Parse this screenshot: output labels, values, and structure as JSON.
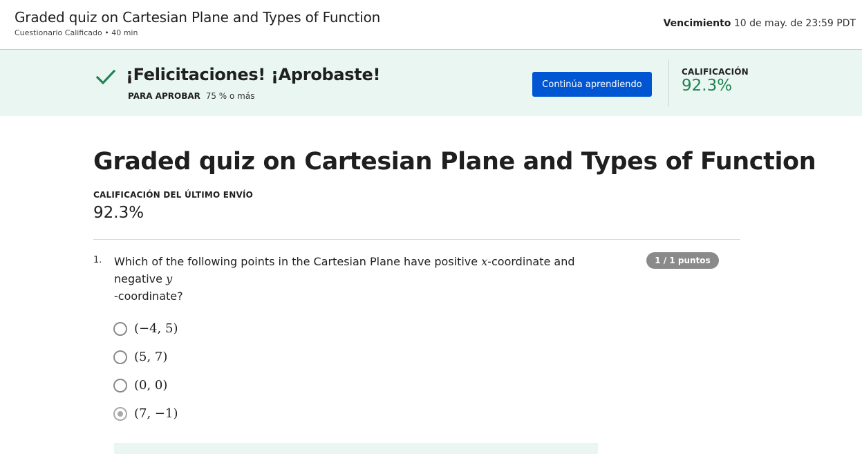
{
  "header": {
    "title": "Graded quiz on Cartesian Plane and Types of Function",
    "subtitle": "Cuestionario Calificado • 40 min",
    "due_label": "Vencimiento",
    "due_value": "10 de may. de 23:59 PDT"
  },
  "banner": {
    "headline": "¡Felicitaciones! ¡Aprobaste!",
    "pass_label": "PARA APROBAR",
    "pass_value": "75 % o más",
    "continue_label": "Continúa aprendiendo",
    "grade_label": "CALIFICACIÓN",
    "grade_value": "92.3%",
    "success_color": "#1f8354",
    "accent_color": "#0056d2",
    "icon": "checkmark-icon"
  },
  "main": {
    "title": "Graded quiz on Cartesian Plane and Types of Function",
    "last_label": "CALIFICACIÓN DEL ÚLTIMO ENVÍO",
    "last_value": "92.3%"
  },
  "question": {
    "number": "1.",
    "text_part1": "Which of the following points in the Cartesian Plane have positive ",
    "var_x": "x",
    "text_part2": "-coordinate and negative ",
    "var_y": "y",
    "text_part3": "-coordinate?",
    "points": "1 / 1 puntos",
    "options": [
      {
        "label": "(−4, 5)",
        "selected": false
      },
      {
        "label": "(5, 7)",
        "selected": false
      },
      {
        "label": "(0, 0)",
        "selected": false
      },
      {
        "label": "(7, −1)",
        "selected": true
      }
    ]
  }
}
